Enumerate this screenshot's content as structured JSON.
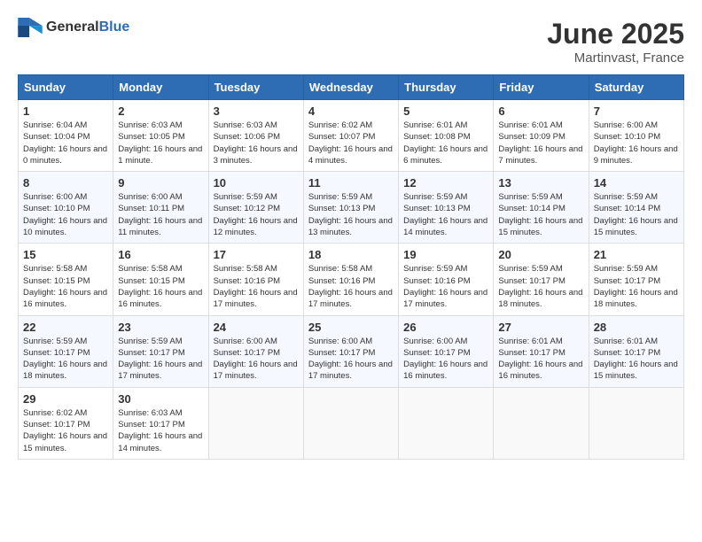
{
  "header": {
    "logo_general": "General",
    "logo_blue": "Blue",
    "month": "June 2025",
    "location": "Martinvast, France"
  },
  "calendar": {
    "weekdays": [
      "Sunday",
      "Monday",
      "Tuesday",
      "Wednesday",
      "Thursday",
      "Friday",
      "Saturday"
    ],
    "weeks": [
      [
        {
          "day": "1",
          "sunrise": "6:04 AM",
          "sunset": "10:04 PM",
          "daylight": "16 hours and 0 minutes."
        },
        {
          "day": "2",
          "sunrise": "6:03 AM",
          "sunset": "10:05 PM",
          "daylight": "16 hours and 1 minute."
        },
        {
          "day": "3",
          "sunrise": "6:03 AM",
          "sunset": "10:06 PM",
          "daylight": "16 hours and 3 minutes."
        },
        {
          "day": "4",
          "sunrise": "6:02 AM",
          "sunset": "10:07 PM",
          "daylight": "16 hours and 4 minutes."
        },
        {
          "day": "5",
          "sunrise": "6:01 AM",
          "sunset": "10:08 PM",
          "daylight": "16 hours and 6 minutes."
        },
        {
          "day": "6",
          "sunrise": "6:01 AM",
          "sunset": "10:09 PM",
          "daylight": "16 hours and 7 minutes."
        },
        {
          "day": "7",
          "sunrise": "6:00 AM",
          "sunset": "10:10 PM",
          "daylight": "16 hours and 9 minutes."
        }
      ],
      [
        {
          "day": "8",
          "sunrise": "6:00 AM",
          "sunset": "10:10 PM",
          "daylight": "16 hours and 10 minutes."
        },
        {
          "day": "9",
          "sunrise": "6:00 AM",
          "sunset": "10:11 PM",
          "daylight": "16 hours and 11 minutes."
        },
        {
          "day": "10",
          "sunrise": "5:59 AM",
          "sunset": "10:12 PM",
          "daylight": "16 hours and 12 minutes."
        },
        {
          "day": "11",
          "sunrise": "5:59 AM",
          "sunset": "10:13 PM",
          "daylight": "16 hours and 13 minutes."
        },
        {
          "day": "12",
          "sunrise": "5:59 AM",
          "sunset": "10:13 PM",
          "daylight": "16 hours and 14 minutes."
        },
        {
          "day": "13",
          "sunrise": "5:59 AM",
          "sunset": "10:14 PM",
          "daylight": "16 hours and 15 minutes."
        },
        {
          "day": "14",
          "sunrise": "5:59 AM",
          "sunset": "10:14 PM",
          "daylight": "16 hours and 15 minutes."
        }
      ],
      [
        {
          "day": "15",
          "sunrise": "5:58 AM",
          "sunset": "10:15 PM",
          "daylight": "16 hours and 16 minutes."
        },
        {
          "day": "16",
          "sunrise": "5:58 AM",
          "sunset": "10:15 PM",
          "daylight": "16 hours and 16 minutes."
        },
        {
          "day": "17",
          "sunrise": "5:58 AM",
          "sunset": "10:16 PM",
          "daylight": "16 hours and 17 minutes."
        },
        {
          "day": "18",
          "sunrise": "5:58 AM",
          "sunset": "10:16 PM",
          "daylight": "16 hours and 17 minutes."
        },
        {
          "day": "19",
          "sunrise": "5:59 AM",
          "sunset": "10:16 PM",
          "daylight": "16 hours and 17 minutes."
        },
        {
          "day": "20",
          "sunrise": "5:59 AM",
          "sunset": "10:17 PM",
          "daylight": "16 hours and 18 minutes."
        },
        {
          "day": "21",
          "sunrise": "5:59 AM",
          "sunset": "10:17 PM",
          "daylight": "16 hours and 18 minutes."
        }
      ],
      [
        {
          "day": "22",
          "sunrise": "5:59 AM",
          "sunset": "10:17 PM",
          "daylight": "16 hours and 18 minutes."
        },
        {
          "day": "23",
          "sunrise": "5:59 AM",
          "sunset": "10:17 PM",
          "daylight": "16 hours and 17 minutes."
        },
        {
          "day": "24",
          "sunrise": "6:00 AM",
          "sunset": "10:17 PM",
          "daylight": "16 hours and 17 minutes."
        },
        {
          "day": "25",
          "sunrise": "6:00 AM",
          "sunset": "10:17 PM",
          "daylight": "16 hours and 17 minutes."
        },
        {
          "day": "26",
          "sunrise": "6:00 AM",
          "sunset": "10:17 PM",
          "daylight": "16 hours and 16 minutes."
        },
        {
          "day": "27",
          "sunrise": "6:01 AM",
          "sunset": "10:17 PM",
          "daylight": "16 hours and 16 minutes."
        },
        {
          "day": "28",
          "sunrise": "6:01 AM",
          "sunset": "10:17 PM",
          "daylight": "16 hours and 15 minutes."
        }
      ],
      [
        {
          "day": "29",
          "sunrise": "6:02 AM",
          "sunset": "10:17 PM",
          "daylight": "16 hours and 15 minutes."
        },
        {
          "day": "30",
          "sunrise": "6:03 AM",
          "sunset": "10:17 PM",
          "daylight": "16 hours and 14 minutes."
        },
        null,
        null,
        null,
        null,
        null
      ]
    ]
  }
}
